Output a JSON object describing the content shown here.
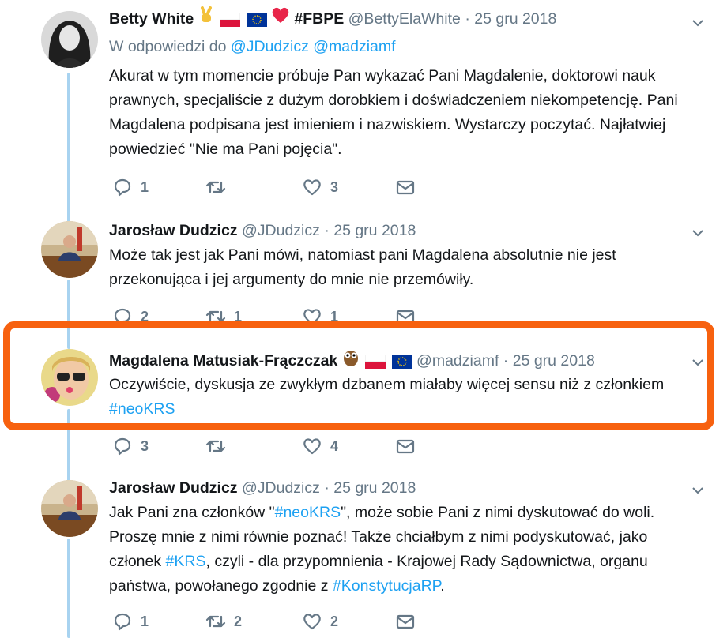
{
  "tweets": [
    {
      "name": "Betty White",
      "name_tag": "#FBPE",
      "handle": "@BettyElaWhite",
      "separator": "·",
      "date": "25 gru 2018",
      "reply_prefix": "W odpowiedzi do",
      "reply_to_1": "@JDudzicz",
      "reply_to_2": "@madziamf",
      "text": "Akurat w tym momencie próbuje Pan wykazać Pani Magdalenie, doktorowi nauk prawnych, specjaliście z dużym dorobkiem i doświadczeniem niekompetencję. Pani Magdalena podpisana jest imieniem i nazwiskiem. Wystarczy poczytać. Najłatwiej powiedzieć \"Nie ma Pani pojęcia\".",
      "replies": "1",
      "retweets": "",
      "likes": "3"
    },
    {
      "name": "Jarosław Dudzicz",
      "handle": "@JDudzicz",
      "separator": "·",
      "date": "25 gru 2018",
      "text": "Może tak jest jak Pani mówi, natomiast  pani Magdalena absolutnie nie jest przekonująca i jej argumenty do mnie nie przemówiły.",
      "replies": "2",
      "retweets": "1",
      "likes": "1"
    },
    {
      "name": "Magdalena Matusiak-Frączczak",
      "handle": "@madziamf",
      "separator": "·",
      "date": "25 gru 2018",
      "text_part1": "Oczywiście, dyskusja ze zwykłym dzbanem miałaby więcej sensu niż z członkiem",
      "hashtag": "#neoKRS",
      "replies": "3",
      "retweets": "",
      "likes": "4"
    },
    {
      "name": "Jarosław Dudzicz",
      "handle": "@JDudzicz",
      "separator": "·",
      "date": "25 gru 2018",
      "t1": "Jak Pani zna członków \"",
      "h1": "#neoKRS",
      "t2": "\", może sobie Pani z nimi dyskutować do woli. Proszę mnie z nimi równie poznać! Także chciałbym z nimi podyskutować, jako członek ",
      "h2": "#KRS",
      "t3": ", czyli - dla przypomnienia - Krajowej Rady Sądownictwa, organu państwa, powołanego zgodnie z ",
      "h3": "#KonstytucjaRP",
      "t4": ".",
      "replies": "1",
      "retweets": "2",
      "likes": "2"
    }
  ],
  "colors": {
    "link": "#1da1f2",
    "muted": "#657786",
    "thread": "#a8d3f0",
    "highlight": "#f7610f"
  },
  "icons": [
    "reply-icon",
    "retweet-icon",
    "like-icon",
    "message-icon",
    "chevron-down-icon"
  ]
}
